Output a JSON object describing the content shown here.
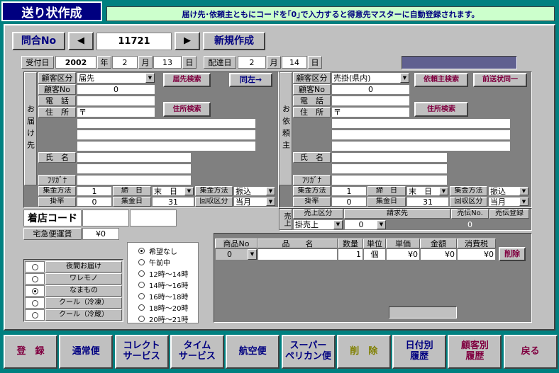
{
  "header": {
    "title": "送り状作成",
    "notice": "届け先･依頼主ともにコードを｢0｣で入力すると得意先マスターに自動登録されます。"
  },
  "nav": {
    "toiawase": "問合No",
    "prev": "◀",
    "next": "▶",
    "number": "11721",
    "new": "新規作成"
  },
  "date": {
    "receipt_label": "受付日",
    "year": "2002",
    "year_unit": "年",
    "month": "2",
    "month_unit": "月",
    "day": "13",
    "day_unit": "日",
    "delivery_label": "配達日",
    "d_month": "2",
    "d_day": "14"
  },
  "dest": {
    "side": "お届け先",
    "kokyaku_label": "顧客区分",
    "kokyaku_value": "届先",
    "search": "届先検索",
    "copy": "同左→",
    "no_label": "顧客No",
    "no_value": "0",
    "tel_label": "電　話",
    "addr_label": "住　所",
    "zip": "〒",
    "addr_search": "住所検索",
    "name_label": "氏　名",
    "kana_label": "ﾌﾘｶﾞﾅ",
    "shukin_label": "集金方法",
    "shukin_value": "1",
    "shime_label": "締　日",
    "shime_value": "末　日",
    "shukin2_label": "集金方法",
    "shukin2_value": "振込",
    "kake_label": "掛率",
    "kake_value": "0",
    "shukinbi_label": "集金日",
    "shukinbi_value": "31",
    "kaishu_label": "回収区分",
    "kaishu_value": "当月"
  },
  "client": {
    "side": "お依頼主",
    "kokyaku_label": "顧客区分",
    "kokyaku_value": "売掛(県内)",
    "search": "依頼主検索",
    "prev": "前送状同一",
    "no_label": "顧客No",
    "no_value": "0",
    "tel_label": "電　話",
    "addr_label": "住　所",
    "zip": "〒",
    "addr_search": "住所検索",
    "name_label": "氏　名",
    "kana_label": "ﾌﾘｶﾞﾅ",
    "shukin_label": "集金方法",
    "shukin_value": "1",
    "shime_label": "締　日",
    "shime_value": "末　日",
    "shukin2_label": "集金方法",
    "shukin2_value": "振込",
    "kake_label": "掛率",
    "kake_value": "0",
    "shukinbi_label": "集金日",
    "shukinbi_value": "31",
    "kaishu_label": "回収区分",
    "kaishu_value": "当月"
  },
  "store": {
    "label": "着店コード",
    "fare_label": "宅急便運賃",
    "fare_value": "¥0"
  },
  "sales": {
    "side": "売上",
    "kubun_label": "売上区分",
    "kubun_value": "掛売上",
    "seikyu_label": "請求先",
    "seikyu_value": "0",
    "denno_label": "売伝No.",
    "denno_value": "0",
    "toroku_label": "売伝登録"
  },
  "items": {
    "headers": [
      "商品No",
      "品　　名",
      "数量",
      "単位",
      "単価",
      "金額",
      "消費税"
    ],
    "row": {
      "no": "0",
      "name": "",
      "qty": "1",
      "unit": "個",
      "price": "¥0",
      "amount": "¥0",
      "tax": "¥0"
    },
    "delete": "削除"
  },
  "delivery_types": [
    {
      "label": "夜間お届け",
      "on": false
    },
    {
      "label": "ワレモノ",
      "on": false
    },
    {
      "label": "なまもの",
      "on": true
    },
    {
      "label": "クール（冷凍）",
      "on": false
    },
    {
      "label": "クール（冷蔵）",
      "on": false
    }
  ],
  "time_slots": [
    {
      "label": "希望なし",
      "on": true
    },
    {
      "label": "午前中",
      "on": false
    },
    {
      "label": "12時～14時",
      "on": false
    },
    {
      "label": "14時～16時",
      "on": false
    },
    {
      "label": "16時～18時",
      "on": false
    },
    {
      "label": "18時～20時",
      "on": false
    },
    {
      "label": "20時～21時",
      "on": false
    }
  ],
  "footer": [
    "登　録",
    "通常便",
    "コレクト\nサービス",
    "タイム\nサービス",
    "航空便",
    "スーパー\nペリカン便",
    "削　除",
    "日付別\n履歴",
    "顧客別\n履歴",
    "戻る"
  ],
  "colors": {
    "teal": "#008080",
    "navy": "#000080",
    "maroon": "#800040",
    "panel_grey": "#808080",
    "notice_bg": "#ccffcc",
    "accent_slate": "#606090"
  }
}
